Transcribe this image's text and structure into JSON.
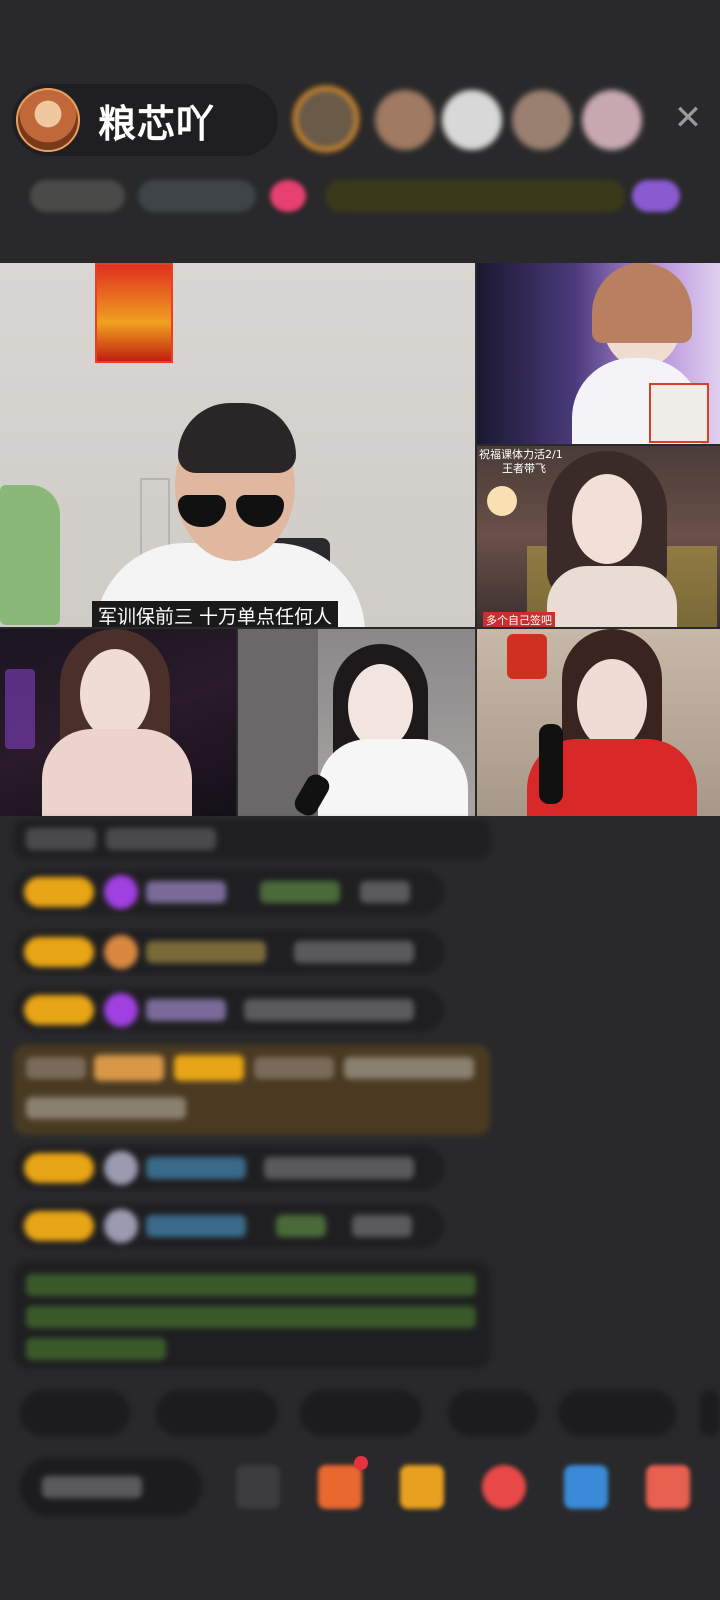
{
  "header": {
    "host_name": "粮芯吖",
    "close_icon": "close-icon"
  },
  "video": {
    "main_caption": "军训保前三 十万单点任何人",
    "tile_b_top": "祝福课体力活2/1",
    "tile_b_sub": "王者带飞",
    "tile_b_tag": "多个自己签吧"
  },
  "colors": {
    "badge": "#e8a515",
    "background": "#29292b",
    "pill": "#1f1f21"
  }
}
